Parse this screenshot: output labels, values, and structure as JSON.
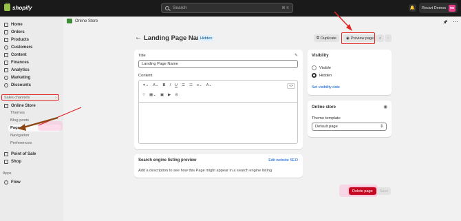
{
  "topbar": {
    "logo_text": "shopify",
    "search_placeholder": "Search",
    "search_shortcut": "⌘ K",
    "store_name": "Recart Demos",
    "avatar_initials": "RD"
  },
  "sidebar": {
    "items": [
      {
        "label": "Home",
        "icon": "home-icon"
      },
      {
        "label": "Orders",
        "icon": "orders-icon"
      },
      {
        "label": "Products",
        "icon": "products-icon"
      },
      {
        "label": "Customers",
        "icon": "customers-icon"
      },
      {
        "label": "Content",
        "icon": "content-icon"
      },
      {
        "label": "Finances",
        "icon": "finances-icon"
      },
      {
        "label": "Analytics",
        "icon": "analytics-icon"
      },
      {
        "label": "Marketing",
        "icon": "marketing-icon"
      },
      {
        "label": "Discounts",
        "icon": "discounts-icon"
      }
    ],
    "sales_channels_label": "Sales channels",
    "online_store_label": "Online Store",
    "sub_items": [
      "Themes",
      "Blog posts",
      "Pages",
      "Navigation",
      "Preferences"
    ],
    "point_of_sale_label": "Point of Sale",
    "shop_label": "Shop",
    "apps_label": "Apps",
    "flow_label": "Flow"
  },
  "header": {
    "crumb": "Online Store",
    "title": "Landing Page Name",
    "badge": "Hidden",
    "duplicate_label": "Duplicate",
    "preview_label": "Preview page"
  },
  "main_card": {
    "title_label": "Title",
    "title_value": "Landing Page Name",
    "content_label": "Content"
  },
  "seo_card": {
    "title": "Search engine listing preview",
    "edit_link": "Edit website SEO",
    "description": "Add a description to see how this Page might appear in a search engine listing"
  },
  "visibility_card": {
    "title": "Visibility",
    "options": [
      "Visible",
      "Hidden"
    ],
    "selected": "Hidden",
    "date_link": "Set visibility date"
  },
  "online_store_card": {
    "title": "Online store",
    "template_label": "Theme template",
    "template_value": "Default page"
  },
  "footer": {
    "delete_label": "Delete page",
    "save_label": "Save"
  },
  "colors": {
    "annotation_red": "#e02424",
    "arrow_brown": "#8b4513",
    "delete_red": "#c70a24",
    "link_blue": "#005bd3"
  }
}
